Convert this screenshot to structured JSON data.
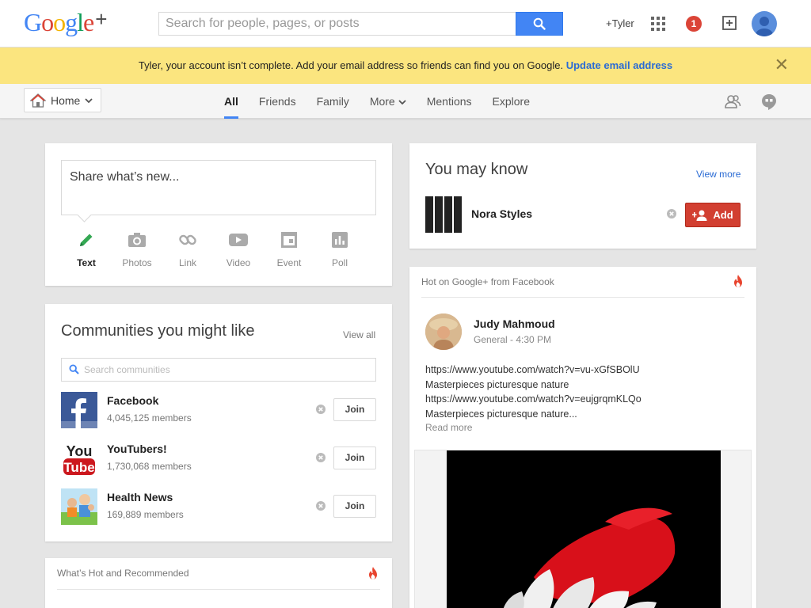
{
  "header": {
    "logo_text": "Google",
    "logo_plus": "+",
    "search_placeholder": "Search for people, pages, or posts",
    "profile_link": "+Tyler",
    "notification_count": "1"
  },
  "banner": {
    "message": "Tyler, your account isn’t complete. Add your email address so friends can find you on Google.",
    "link": "Update email address"
  },
  "nav": {
    "home_label": "Home",
    "tabs": [
      "All",
      "Friends",
      "Family",
      "More",
      "Mentions",
      "Explore"
    ],
    "active_tab": "All"
  },
  "share": {
    "placeholder": "Share what’s new...",
    "actions": [
      "Text",
      "Photos",
      "Link",
      "Video",
      "Event",
      "Poll"
    ]
  },
  "communities": {
    "title": "Communities you might like",
    "view_all": "View all",
    "search_placeholder": "Search communities",
    "join_label": "Join",
    "items": [
      {
        "name": "Facebook",
        "members": "4,045,125 members"
      },
      {
        "name": "YouTubers!",
        "members": "1,730,068 members"
      },
      {
        "name": "Health News",
        "members": "169,889 members"
      }
    ]
  },
  "hot_recommended": {
    "title": "What’s Hot and Recommended"
  },
  "you_may_know": {
    "title": "You may know",
    "view_more": "View more",
    "person": "Nora Styles",
    "add_label": "Add"
  },
  "hot_facebook": {
    "title": "Hot on Google+ from Facebook",
    "post": {
      "author": "Judy Mahmoud",
      "meta": "General  -  4:30 PM",
      "lines": [
        "https://www.youtube.com/watch?v=vu-xGfSBOlU",
        "Masterpieces picturesque nature",
        "https://www.youtube.com/watch?v=eujgrqmKLQo",
        "Masterpieces picturesque nature..."
      ],
      "read_more": "Read more"
    }
  },
  "colors": {
    "accent_blue": "#4285f4",
    "banner_yellow": "#fbe57f",
    "add_red": "#d23f31",
    "notif_red": "#db4437"
  }
}
